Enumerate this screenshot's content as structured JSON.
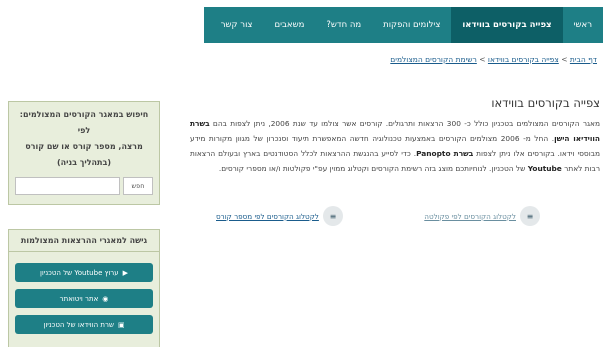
{
  "nav": {
    "items": [
      {
        "label": "ראשי"
      },
      {
        "label": "צפייה בקורסים בווידאו"
      },
      {
        "label": "צילומים והפקות"
      },
      {
        "label": "מה חדש?"
      },
      {
        "label": "משאבים"
      },
      {
        "label": "צור קשר"
      }
    ],
    "active_index": 1,
    "bar_color": "#1e7f86",
    "active_color": "#0d5f66"
  },
  "breadcrumb": {
    "home": "דף הבית",
    "section": "צפייה בקורסים בווידאו",
    "current": "רשימת הקורסים המצולמים",
    "separator": ">"
  },
  "main": {
    "title": "צפייה בקורסים בווידאו",
    "para_1": "מאגר הקורסים המצולמים בטכניון כולל כ- 300 הרצאות ותרגולים. קורסים אשר צולמו עד שנת 2006, ניתן לצפות",
    "para_2a": "בהם ",
    "para_2b": "בשרת הווידיאו הישן",
    "para_2c": ". החל מ- 2006 מצולמים הקורסים באמצעות טכנולוגיה חדשה המאפשרת תיעוד וסנכרון",
    "para_3a": "של מגוון מקורות מידע מבוססי וידאו. בקורסים אלו ניתן לצפות ",
    "para_3b": "בשרת Panopto",
    "para_3c": ". כדי לסייע בהנגשת ההרצאות לכלל",
    "para_4a": "הסטודנטים בארץ ובעולם הרצאות רבות לאתר ",
    "para_4b": "Youtube",
    "para_4c": " של הטכניון. לנוחיותכם מוצג בזה רשימת הקורסים וקטלוג ממוין",
    "para_5": "עפ\"י פקולטות ו/או מספרי קורסים."
  },
  "links": {
    "by_faculty": "לקטלוג הקורסים לפי פקולטה",
    "by_course": "לקטלוג הקורסים לפי מספר קורס",
    "icon": "list-icon"
  },
  "search_box": {
    "title_line1": "חיפוש במאגר הקורסים המצולמים: לפי",
    "title_line2": "מרצה, מספר קורס או שם קורס",
    "title_line3": "(בתהליך בניה)",
    "input_value": "",
    "button_label": "חפש"
  },
  "access_box": {
    "title": "גישה למאגרי ההרצאות המצולמות",
    "buttons": [
      {
        "label": "ערוץ Youtube של הטכניון",
        "icon": "youtube-icon"
      },
      {
        "label": "אתר ויטואתר",
        "icon": "circle-play-icon"
      },
      {
        "label": "שרת הווידאו של הטכניון",
        "icon": "server-icon"
      }
    ]
  },
  "colors": {
    "sidebar_bg": "#e8eedc",
    "link": "#1a5c8c"
  }
}
